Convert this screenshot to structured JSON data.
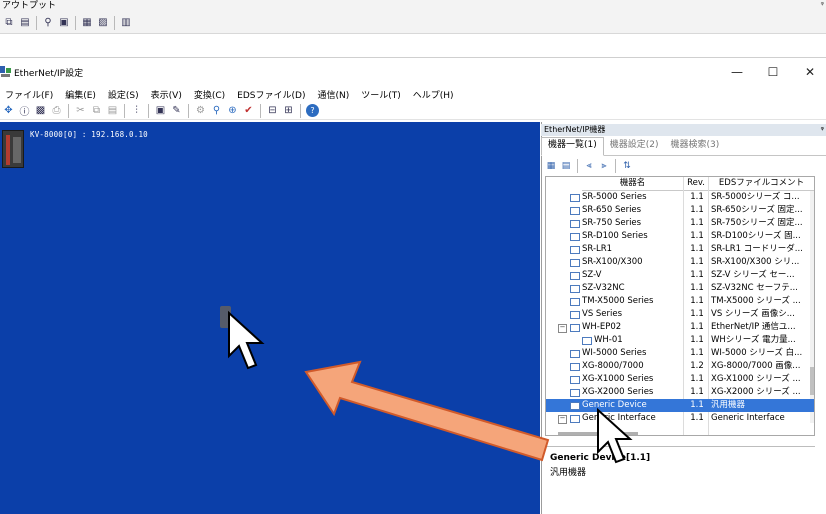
{
  "output_panel": {
    "title": "アウトプット",
    "pin": "ᵠ",
    "tools": [
      "copy-icon",
      "clipboard-icon",
      "find-icon",
      "save-icon",
      "filter-icon",
      "clear-icon",
      "grid-icon"
    ]
  },
  "window": {
    "title": "EtherNet/IP設定",
    "minimize": "—",
    "maximize": "☐",
    "close": "✕"
  },
  "menu": [
    "ファイル(F)",
    "編集(E)",
    "設定(S)",
    "表示(V)",
    "変換(C)",
    "EDSファイル(D)",
    "通信(N)",
    "ツール(T)",
    "ヘルプ(H)"
  ],
  "canvas": {
    "device_label": "KV-8000[0] : 192.168.0.10",
    "background": "#0b3fa9"
  },
  "side_panel": {
    "title": "EtherNet/IP機器",
    "pin": "ᵠ",
    "tabs": [
      "機器一覧(1)",
      "機器設定(2)",
      "機器検索(3)"
    ],
    "columns": [
      "機器名",
      "Rev.",
      "EDSファイルコメント"
    ],
    "rows": [
      {
        "name": "SR-5000 Series",
        "rev": "1.1",
        "comment": "SR-5000シリーズ コ..."
      },
      {
        "name": "SR-650 Series",
        "rev": "1.1",
        "comment": "SR-650シリーズ 固定..."
      },
      {
        "name": "SR-750 Series",
        "rev": "1.1",
        "comment": "SR-750シリーズ 固定..."
      },
      {
        "name": "SR-D100 Series",
        "rev": "1.1",
        "comment": "SR-D100シリーズ 固..."
      },
      {
        "name": "SR-LR1",
        "rev": "1.1",
        "comment": "SR-LR1 コードリーダ..."
      },
      {
        "name": "SR-X100/X300",
        "rev": "1.1",
        "comment": "SR-X100/X300 シリ..."
      },
      {
        "name": "SZ-V",
        "rev": "1.1",
        "comment": "SZ-V シリーズ セー..."
      },
      {
        "name": "SZ-V32NC",
        "rev": "1.1",
        "comment": "SZ-V32NC セーフテ..."
      },
      {
        "name": "TM-X5000 Series",
        "rev": "1.1",
        "comment": "TM-X5000 シリーズ ..."
      },
      {
        "name": "VS Series",
        "rev": "1.1",
        "comment": "VS シリーズ 画像シ..."
      },
      {
        "name": "WH-EP02",
        "rev": "1.1",
        "comment": "EtherNet/IP 通信ユ..."
      },
      {
        "name": "WH-01",
        "rev": "1.1",
        "comment": "WHシリーズ 電力量..."
      },
      {
        "name": "WI-5000 Series",
        "rev": "1.1",
        "comment": "WI-5000 シリーズ 白..."
      },
      {
        "name": "XG-8000/7000",
        "rev": "1.2",
        "comment": "XG-8000/7000 画像..."
      },
      {
        "name": "XG-X1000 Series",
        "rev": "1.1",
        "comment": "XG-X1000 シリーズ ..."
      },
      {
        "name": "XG-X2000 Series",
        "rev": "1.1",
        "comment": "XG-X2000 シリーズ ..."
      },
      {
        "name": "Generic Device",
        "rev": "1.1",
        "comment": "汎用機器"
      },
      {
        "name": "Generic Interface",
        "rev": "1.1",
        "comment": "Generic Interface"
      }
    ],
    "info_name": "Generic Device[1.1]",
    "info_desc": "汎用機器"
  }
}
